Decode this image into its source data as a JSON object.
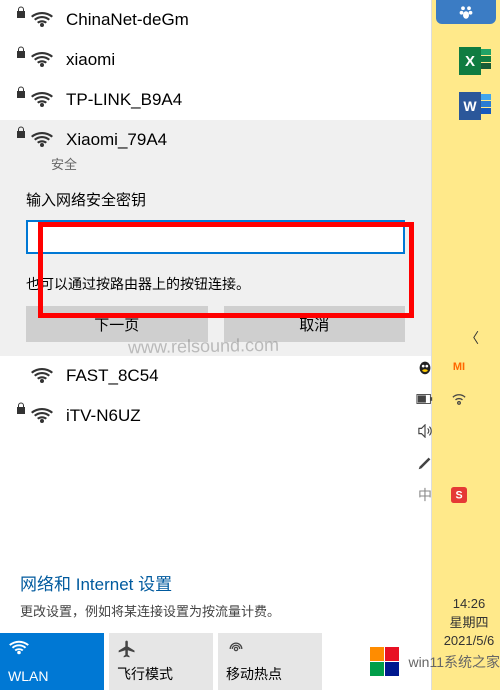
{
  "wifi_list": [
    {
      "ssid": "ChinaNet-deGm",
      "secured": true
    },
    {
      "ssid": "xiaomi",
      "secured": true
    },
    {
      "ssid": "TP-LINK_B9A4",
      "secured": true
    },
    {
      "ssid": "Xiaomi_79A4",
      "secured": true,
      "security_label": "安全"
    },
    {
      "ssid": "FAST_8C54",
      "secured": false
    },
    {
      "ssid": "iTV-N6UZ",
      "secured": true
    }
  ],
  "connect": {
    "prompt": "输入网络安全密钥",
    "input_value": "",
    "hint": "也可以通过按路由器上的按钮连接。",
    "next_button": "下一页",
    "cancel_button": "取消"
  },
  "settings": {
    "title": "网络和 Internet 设置",
    "sub": "更改设置，例如将某连接设置为按流量计费。"
  },
  "toggles": {
    "wlan": "WLAN",
    "airplane": "飞行模式",
    "hotspot": "移动热点"
  },
  "clock": {
    "time": "14:26",
    "weekday": "星期四",
    "date": "2021/5/6"
  },
  "watermark": "www.relsound.com",
  "logo_text": "win11系统之家",
  "tray_icons": {
    "expand": "expand-chevron",
    "qq": "qq-icon",
    "mi": "mi-icon",
    "battery": "battery-icon",
    "wifi": "wifi-tray-icon",
    "volume": "volume-icon",
    "pen": "pen-icon",
    "ime1": "ime-icon",
    "ime2": "sogou-icon"
  },
  "app_icons": {
    "baidu": "baidu-paw-icon",
    "excel": "excel-icon",
    "word": "word-icon"
  }
}
